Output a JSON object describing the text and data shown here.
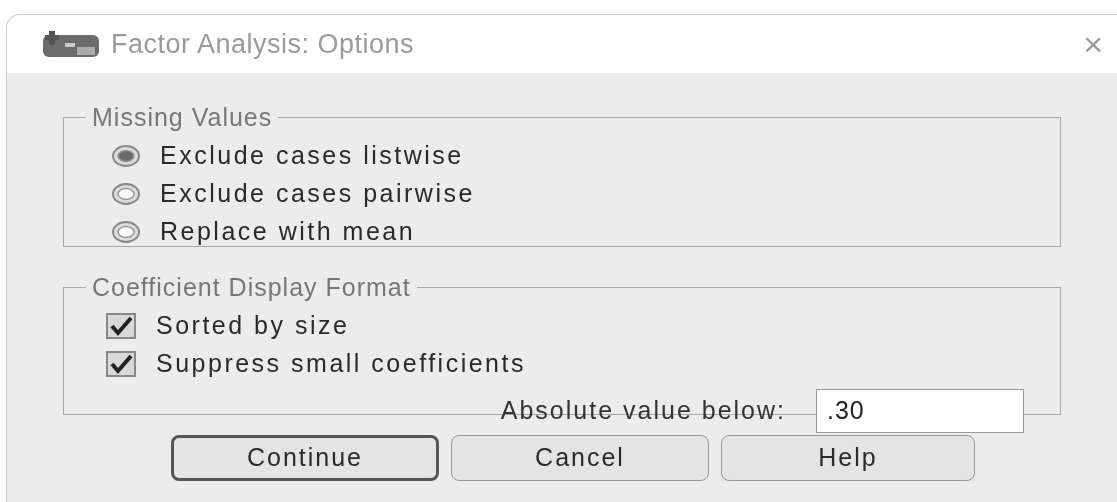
{
  "window": {
    "title": "Factor Analysis: Options",
    "close": "×"
  },
  "missing_values": {
    "legend": "Missing Values",
    "options": [
      {
        "label": "Exclude cases listwise",
        "selected": true
      },
      {
        "label": "Exclude cases pairwise",
        "selected": false
      },
      {
        "label": "Replace with mean",
        "selected": false
      }
    ]
  },
  "coefficient_display_format": {
    "legend": "Coefficient Display Format",
    "options": [
      {
        "label": "Sorted by size",
        "checked": true
      },
      {
        "label": "Suppress small coefficients",
        "checked": true
      }
    ],
    "threshold": {
      "label": "Absolute value below:",
      "value": ".30"
    }
  },
  "buttons": [
    {
      "label": "Continue",
      "default": true
    },
    {
      "label": "Cancel",
      "default": false
    },
    {
      "label": "Help",
      "default": false
    }
  ]
}
